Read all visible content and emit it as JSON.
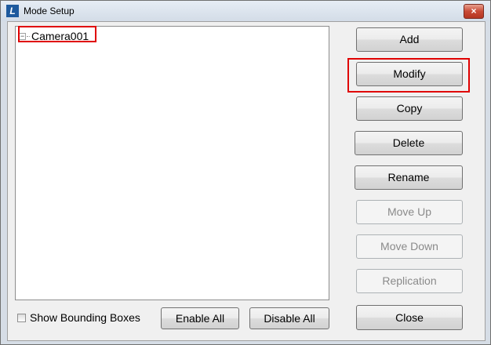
{
  "window": {
    "title": "Mode Setup",
    "close_glyph": "×"
  },
  "tree": {
    "items": [
      {
        "label": "Camera001",
        "expander": "⊟"
      }
    ]
  },
  "buttons": {
    "add": "Add",
    "modify": "Modify",
    "copy": "Copy",
    "delete": "Delete",
    "rename": "Rename",
    "move_up": "Move Up",
    "move_down": "Move Down",
    "replication": "Replication",
    "close": "Close",
    "enable_all": "Enable All",
    "disable_all": "Disable All"
  },
  "options": {
    "show_bounding_boxes": "Show Bounding Boxes",
    "show_bounding_boxes_checked": false
  },
  "colors": {
    "highlight": "#e00000",
    "titlebar": "#dbe3ec",
    "client": "#f0f0f0"
  },
  "icons": {
    "app": "app-logo-icon",
    "close": "close-icon",
    "expander": "collapse-icon"
  }
}
